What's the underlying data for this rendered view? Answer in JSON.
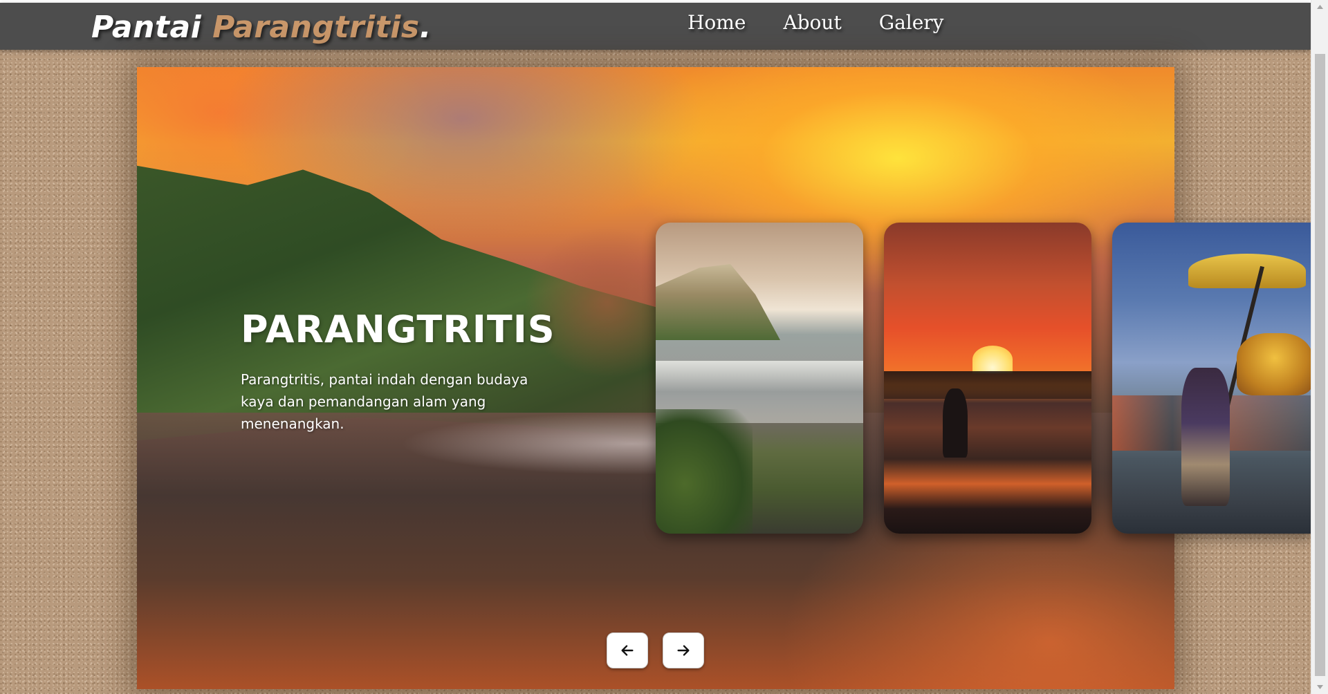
{
  "header": {
    "logo_word1": "Pantai",
    "logo_word2": "Parangtritis",
    "logo_dot": ".",
    "nav": [
      {
        "label": "Home"
      },
      {
        "label": "About"
      },
      {
        "label": "Galery"
      }
    ]
  },
  "hero": {
    "title": "PARANGTRITIS",
    "description": "Parangtritis, pantai indah dengan budaya kaya dan pemandangan alam yang menenangkan."
  },
  "slider": {
    "cards": [
      {
        "subject": "cliff-coast-photo"
      },
      {
        "subject": "sunset-beach-photo"
      },
      {
        "subject": "ceremony-procession-photo"
      }
    ],
    "prev_icon": "arrow-left-icon",
    "next_icon": "arrow-right-icon"
  },
  "colors": {
    "header_bg": "#4d4d4d",
    "logo_accent": "#c9976a",
    "text": "#ffffff",
    "page_bg": "#b89a7d"
  }
}
